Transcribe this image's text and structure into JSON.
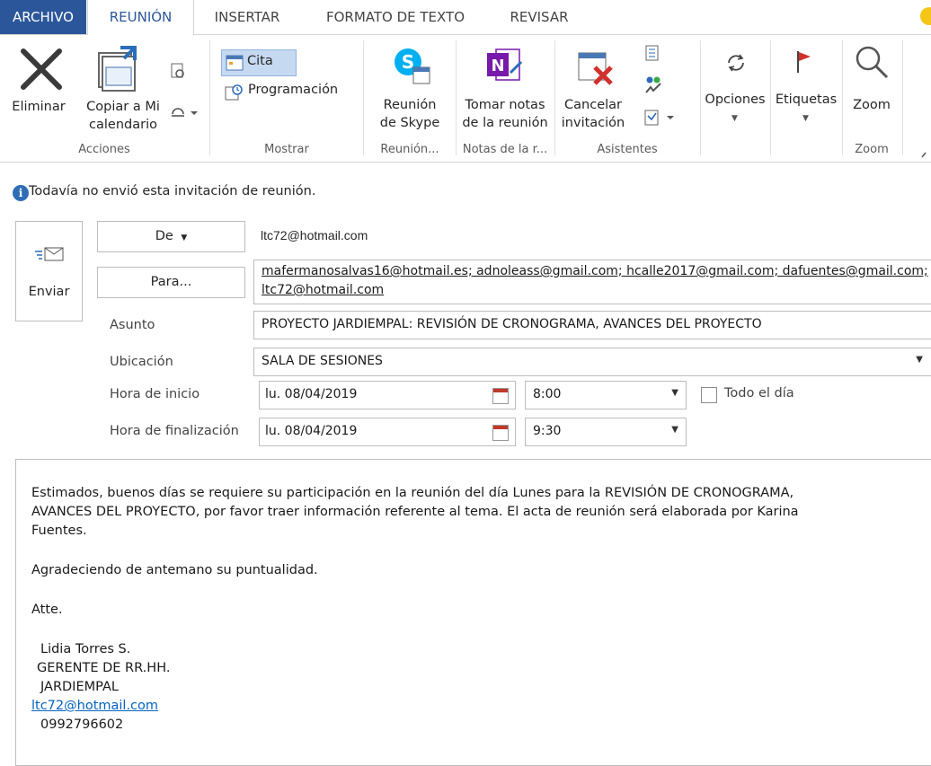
{
  "tabs": [
    "ARCHIVO",
    "REUNIÓN",
    "INSERTAR",
    "FORMATO DE TEXTO",
    "REVISAR"
  ],
  "ribbon": {
    "acciones": {
      "group_label": "Acciones",
      "eliminar": "Eliminar",
      "copiar_line1": "Copiar a Mi",
      "copiar_line2": "calendario"
    },
    "mostrar": {
      "group_label": "Mostrar",
      "cita": "Cita",
      "programacion": "Programación"
    },
    "reunion_skype": {
      "group_label": "Reunión...",
      "line1": "Reunión",
      "line2": "de Skype"
    },
    "notas": {
      "group_label": "Notas de la r...",
      "line1": "Tomar notas",
      "line2": "de la reunión"
    },
    "asistentes": {
      "group_label": "Asistentes",
      "line1": "Cancelar",
      "line2": "invitación"
    },
    "opciones": "Opciones",
    "etiquetas": "Etiquetas",
    "zoom": {
      "group_label": "Zoom",
      "label": "Zoom"
    }
  },
  "info": "Todavía no envió esta invitación de reunión.",
  "form": {
    "send": "Enviar",
    "from_button": "De",
    "from_value": "ltc72@hotmail.com",
    "to_button": "Para...",
    "to_line1": "mafermanosalvas16@hotmail.es; adnoleass@gmail.com; hcalle2017@gmail.com; dafuentes@gmail.com;",
    "to_line2": "ltc72@hotmail.com",
    "subject_label": "Asunto",
    "subject_value": "PROYECTO JARDIEMPAL: REVISIÓN DE CRONOGRAMA, AVANCES DEL PROYECTO",
    "location_label": "Ubicación",
    "location_value": "SALA DE SESIONES",
    "start_label": "Hora de inicio",
    "start_date": "lu. 08/04/2019",
    "start_time": "8:00",
    "allday_label": "Todo el día",
    "end_label": "Hora de finalización",
    "end_date": "lu. 08/04/2019",
    "end_time": "9:30"
  },
  "body": {
    "line1": "Estimados, buenos días se requiere su participación en la reunión del día Lunes para la REVISIÓN DE CRONOGRAMA,",
    "line2": "AVANCES DEL PROYECTO, por favor traer información referente al tema. El acta de reunión será elaborada por Karina",
    "line3": "Fuentes.",
    "thanks": "Agradeciendo de antemano su puntualidad.",
    "atte": "Atte.",
    "sig_name": "Lidia Torres S.",
    "sig_title": "GERENTE DE RR.HH.",
    "sig_company": "JARDIEMPAL",
    "sig_email": "ltc72@hotmail.com",
    "sig_phone": "0992796602"
  }
}
